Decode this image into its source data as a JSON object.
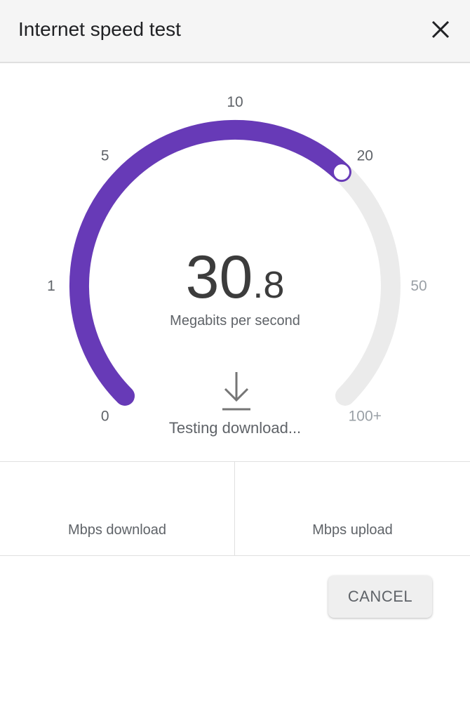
{
  "header": {
    "title": "Internet speed test",
    "close_icon": "close-icon"
  },
  "gauge": {
    "ticks": [
      {
        "label": "0",
        "active": true
      },
      {
        "label": "1",
        "active": true
      },
      {
        "label": "5",
        "active": true
      },
      {
        "label": "10",
        "active": true
      },
      {
        "label": "20",
        "active": true
      },
      {
        "label": "50",
        "active": false
      },
      {
        "label": "100+",
        "active": false
      }
    ],
    "current_value_fraction_of_arc": 0.66,
    "speed_integer": "30",
    "speed_decimal": ".8",
    "unit": "Megabits per second",
    "status": "Testing download...",
    "status_icon": "download-icon"
  },
  "results": {
    "download_label": "Mbps download",
    "upload_label": "Mbps upload"
  },
  "actions": {
    "cancel_label": "CANCEL"
  },
  "colors": {
    "accent": "#673ab7",
    "track": "#ebebeb",
    "active_tick": "#5f6368",
    "inactive_tick": "#9aa0a6"
  }
}
